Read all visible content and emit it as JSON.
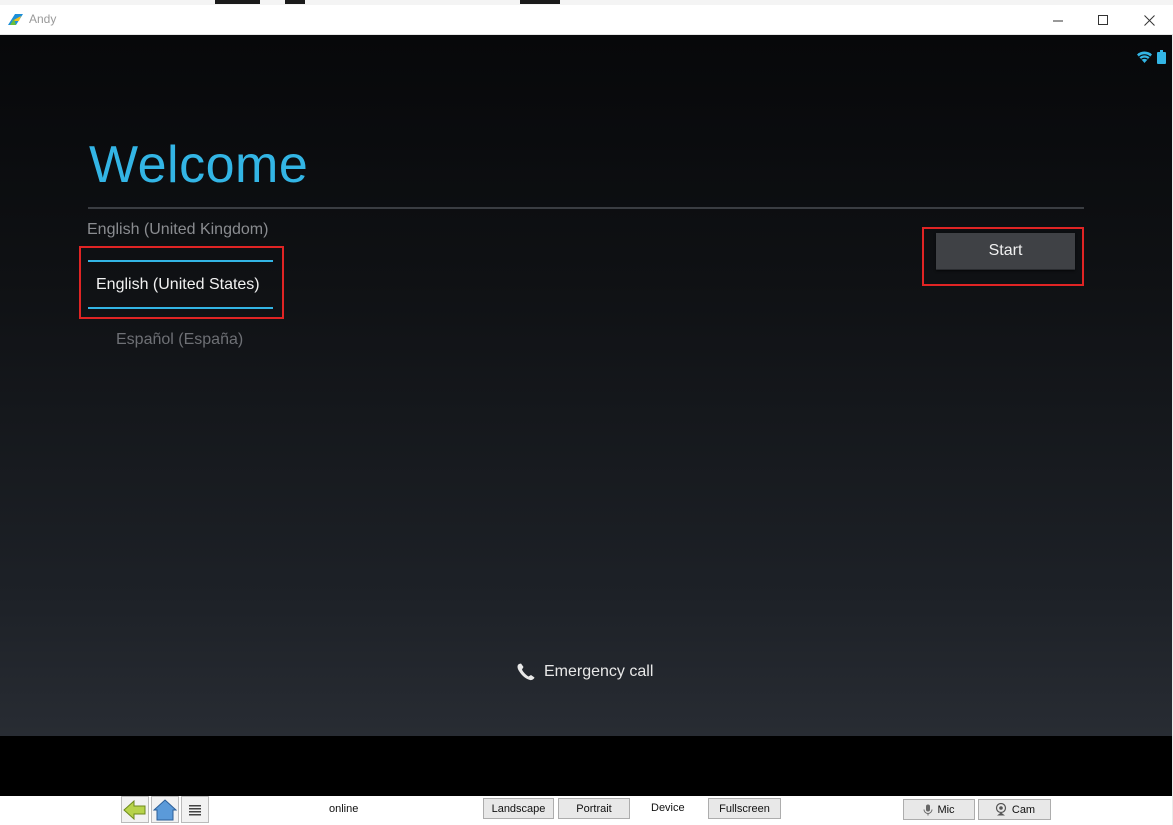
{
  "window": {
    "title": "Andy",
    "controls": {
      "minimize": "minimize-icon",
      "maximize": "maximize-icon",
      "close": "close-icon"
    }
  },
  "android": {
    "status_icons": [
      "wifi-icon",
      "battery-icon"
    ],
    "welcome_title": "Welcome",
    "languages": [
      {
        "label": "English (United Kingdom)",
        "state": "above"
      },
      {
        "label": "English (United States)",
        "state": "selected"
      },
      {
        "label": "Español (España)",
        "state": "below"
      }
    ],
    "start_label": "Start",
    "emergency_label": "Emergency call",
    "accent_color": "#33b5e5"
  },
  "toolbar": {
    "nav_icons": [
      "back-arrow-icon",
      "home-icon",
      "menu-icon"
    ],
    "status": "online",
    "landscape_label": "Landscape",
    "portrait_label": "Portrait",
    "device_label": "Device",
    "fullscreen_label": "Fullscreen",
    "mic_label": "Mic",
    "cam_label": "Cam"
  }
}
